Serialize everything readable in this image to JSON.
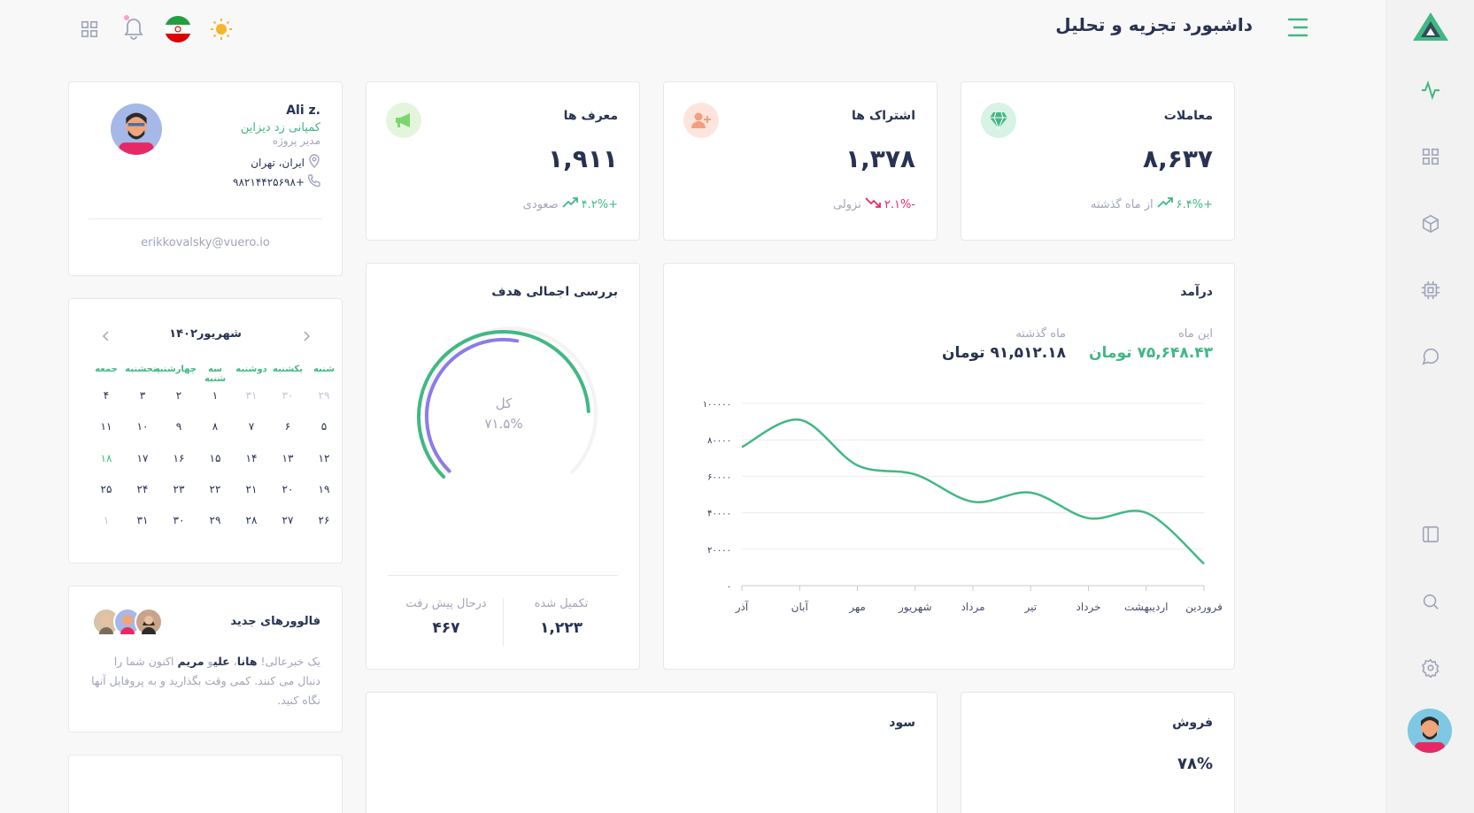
{
  "header": {
    "title": "داشبورد تجزیه و تحلیل"
  },
  "colors": {
    "accent": "#41b883",
    "negative": "#e62965",
    "ring_inner": "#8c7ce6"
  },
  "stats": [
    {
      "label": "معاملات",
      "value": "۸,۶۳۷",
      "change": "+۶.۴%",
      "trend_label": "از ماه گذشته",
      "direction": "up",
      "icon": "diamond-icon"
    },
    {
      "label": "اشتراک ها",
      "value": "۱,۳۷۸",
      "change": "-۲.۱%",
      "trend_label": "نزولی",
      "direction": "down",
      "icon": "add-user-icon"
    },
    {
      "label": "معرف ها",
      "value": "۱,۹۱۱",
      "change": "+۴.۲%",
      "trend_label": "صعودی",
      "direction": "up",
      "icon": "megaphone-icon"
    }
  ],
  "profile": {
    "name": "Ali z.",
    "company": "کمپانی زد دیزاین",
    "role": "مدیر پروژه",
    "location": "ایران، تهران",
    "phone": "+۹۸۲۱۴۴۲۵۶۹۸",
    "email": "erikkovalsky@vuero.io"
  },
  "calendar": {
    "title": "شهریور۱۴۰۲",
    "weekdays": [
      "شنبه",
      "یکشنبه",
      "دوشنبه",
      "سه شنبه",
      "چهارشنبه",
      "پنجشنبه",
      "جمعه"
    ],
    "weeks": [
      [
        "۲۹",
        "۳۰",
        "۳۱",
        "۱",
        "۲",
        "۳",
        "۴"
      ],
      [
        "۵",
        "۶",
        "۷",
        "۸",
        "۹",
        "۱۰",
        "۱۱"
      ],
      [
        "۱۲",
        "۱۳",
        "۱۴",
        "۱۵",
        "۱۶",
        "۱۷",
        "۱۸"
      ],
      [
        "۱۹",
        "۲۰",
        "۲۱",
        "۲۲",
        "۲۳",
        "۲۴",
        "۲۵"
      ],
      [
        "۲۶",
        "۲۷",
        "۲۸",
        "۲۹",
        "۳۰",
        "۳۱",
        "۱"
      ]
    ]
  },
  "followers": {
    "title": "فالوورهای جدید",
    "text_prefix": "یک خبرعالی! ",
    "name1": "هانا",
    "sep1": "، ",
    "name2": "علی",
    "sep2": "و ",
    "name3": "مریم",
    "text_suffix": " اکنون شما را دنبال می کنند. کمی وقت بگذارید و به پروفایل آنها نگاه کنید."
  },
  "goal": {
    "title": "بررسی اجمالی هدف",
    "center_label": "کل",
    "center_value": "۷۱.۵%",
    "percent": 71.5,
    "completed_label": "تکمیل شده",
    "completed_value": "۱,۲۲۳",
    "inprogress_label": "درحال پیش رفت",
    "inprogress_value": "۴۶۷"
  },
  "revenue": {
    "title": "درآمد",
    "this_month_label": "این ماه",
    "this_month_value": "۷۵,۶۴۸.۴۳ تومان",
    "last_month_label": "ماه گذشته",
    "last_month_value": "۹۱,۵۱۲.۱۸ تومان"
  },
  "bottom": {
    "profit_title": "سود",
    "sales_title": "فروش",
    "sales_value": "۷۸%"
  },
  "chart_data": {
    "type": "line",
    "categories": [
      "فروردین",
      "اردیبهشت",
      "خرداد",
      "تیر",
      "مرداد",
      "شهریور",
      "مهر",
      "آبان",
      "آذر"
    ],
    "series": [
      {
        "values": [
          12000,
          40000,
          37000,
          51000,
          46000,
          61000,
          66000,
          91000,
          76000
        ]
      }
    ],
    "yticks": [
      "۰",
      "۲۰۰۰۰",
      "۴۰۰۰۰",
      "۶۰۰۰۰",
      "۸۰۰۰۰",
      "۱۰۰۰۰۰"
    ],
    "ylim": [
      0,
      100000
    ],
    "grid": true
  }
}
